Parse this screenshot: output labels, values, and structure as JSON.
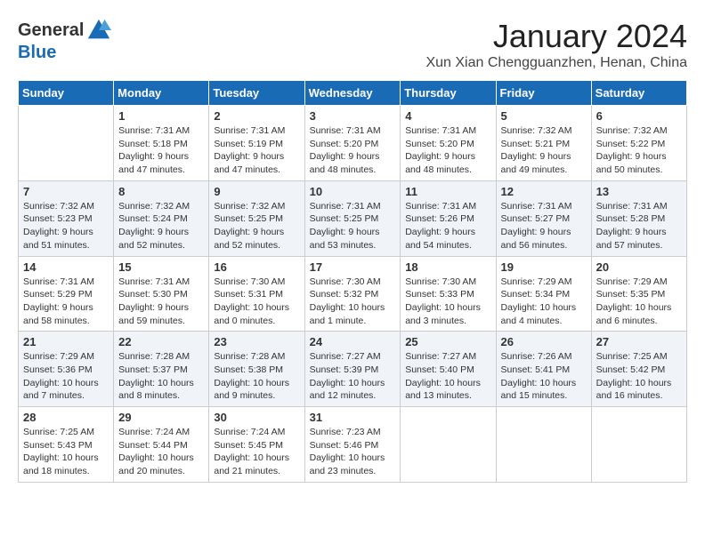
{
  "header": {
    "logo_general": "General",
    "logo_blue": "Blue",
    "title": "January 2024",
    "location": "Xun Xian Chengguanzhen, Henan, China"
  },
  "days_of_week": [
    "Sunday",
    "Monday",
    "Tuesday",
    "Wednesday",
    "Thursday",
    "Friday",
    "Saturday"
  ],
  "weeks": [
    [
      {
        "day": "",
        "info": ""
      },
      {
        "day": "1",
        "info": "Sunrise: 7:31 AM\nSunset: 5:18 PM\nDaylight: 9 hours\nand 47 minutes."
      },
      {
        "day": "2",
        "info": "Sunrise: 7:31 AM\nSunset: 5:19 PM\nDaylight: 9 hours\nand 47 minutes."
      },
      {
        "day": "3",
        "info": "Sunrise: 7:31 AM\nSunset: 5:20 PM\nDaylight: 9 hours\nand 48 minutes."
      },
      {
        "day": "4",
        "info": "Sunrise: 7:31 AM\nSunset: 5:20 PM\nDaylight: 9 hours\nand 48 minutes."
      },
      {
        "day": "5",
        "info": "Sunrise: 7:32 AM\nSunset: 5:21 PM\nDaylight: 9 hours\nand 49 minutes."
      },
      {
        "day": "6",
        "info": "Sunrise: 7:32 AM\nSunset: 5:22 PM\nDaylight: 9 hours\nand 50 minutes."
      }
    ],
    [
      {
        "day": "7",
        "info": "Sunrise: 7:32 AM\nSunset: 5:23 PM\nDaylight: 9 hours\nand 51 minutes."
      },
      {
        "day": "8",
        "info": "Sunrise: 7:32 AM\nSunset: 5:24 PM\nDaylight: 9 hours\nand 52 minutes."
      },
      {
        "day": "9",
        "info": "Sunrise: 7:32 AM\nSunset: 5:25 PM\nDaylight: 9 hours\nand 52 minutes."
      },
      {
        "day": "10",
        "info": "Sunrise: 7:31 AM\nSunset: 5:25 PM\nDaylight: 9 hours\nand 53 minutes."
      },
      {
        "day": "11",
        "info": "Sunrise: 7:31 AM\nSunset: 5:26 PM\nDaylight: 9 hours\nand 54 minutes."
      },
      {
        "day": "12",
        "info": "Sunrise: 7:31 AM\nSunset: 5:27 PM\nDaylight: 9 hours\nand 56 minutes."
      },
      {
        "day": "13",
        "info": "Sunrise: 7:31 AM\nSunset: 5:28 PM\nDaylight: 9 hours\nand 57 minutes."
      }
    ],
    [
      {
        "day": "14",
        "info": "Sunrise: 7:31 AM\nSunset: 5:29 PM\nDaylight: 9 hours\nand 58 minutes."
      },
      {
        "day": "15",
        "info": "Sunrise: 7:31 AM\nSunset: 5:30 PM\nDaylight: 9 hours\nand 59 minutes."
      },
      {
        "day": "16",
        "info": "Sunrise: 7:30 AM\nSunset: 5:31 PM\nDaylight: 10 hours\nand 0 minutes."
      },
      {
        "day": "17",
        "info": "Sunrise: 7:30 AM\nSunset: 5:32 PM\nDaylight: 10 hours\nand 1 minute."
      },
      {
        "day": "18",
        "info": "Sunrise: 7:30 AM\nSunset: 5:33 PM\nDaylight: 10 hours\nand 3 minutes."
      },
      {
        "day": "19",
        "info": "Sunrise: 7:29 AM\nSunset: 5:34 PM\nDaylight: 10 hours\nand 4 minutes."
      },
      {
        "day": "20",
        "info": "Sunrise: 7:29 AM\nSunset: 5:35 PM\nDaylight: 10 hours\nand 6 minutes."
      }
    ],
    [
      {
        "day": "21",
        "info": "Sunrise: 7:29 AM\nSunset: 5:36 PM\nDaylight: 10 hours\nand 7 minutes."
      },
      {
        "day": "22",
        "info": "Sunrise: 7:28 AM\nSunset: 5:37 PM\nDaylight: 10 hours\nand 8 minutes."
      },
      {
        "day": "23",
        "info": "Sunrise: 7:28 AM\nSunset: 5:38 PM\nDaylight: 10 hours\nand 9 minutes."
      },
      {
        "day": "24",
        "info": "Sunrise: 7:27 AM\nSunset: 5:39 PM\nDaylight: 10 hours\nand 12 minutes."
      },
      {
        "day": "25",
        "info": "Sunrise: 7:27 AM\nSunset: 5:40 PM\nDaylight: 10 hours\nand 13 minutes."
      },
      {
        "day": "26",
        "info": "Sunrise: 7:26 AM\nSunset: 5:41 PM\nDaylight: 10 hours\nand 15 minutes."
      },
      {
        "day": "27",
        "info": "Sunrise: 7:25 AM\nSunset: 5:42 PM\nDaylight: 10 hours\nand 16 minutes."
      }
    ],
    [
      {
        "day": "28",
        "info": "Sunrise: 7:25 AM\nSunset: 5:43 PM\nDaylight: 10 hours\nand 18 minutes."
      },
      {
        "day": "29",
        "info": "Sunrise: 7:24 AM\nSunset: 5:44 PM\nDaylight: 10 hours\nand 20 minutes."
      },
      {
        "day": "30",
        "info": "Sunrise: 7:24 AM\nSunset: 5:45 PM\nDaylight: 10 hours\nand 21 minutes."
      },
      {
        "day": "31",
        "info": "Sunrise: 7:23 AM\nSunset: 5:46 PM\nDaylight: 10 hours\nand 23 minutes."
      },
      {
        "day": "",
        "info": ""
      },
      {
        "day": "",
        "info": ""
      },
      {
        "day": "",
        "info": ""
      }
    ]
  ]
}
